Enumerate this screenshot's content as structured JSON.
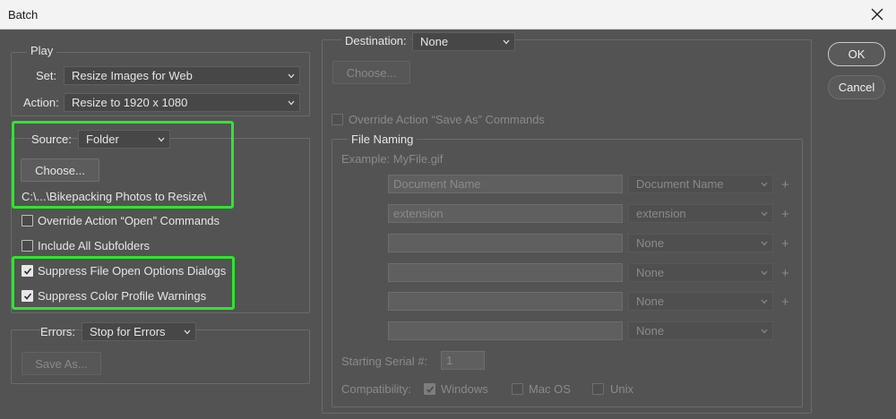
{
  "window": {
    "title": "Batch"
  },
  "play": {
    "legend": "Play",
    "set_label": "Set:",
    "set_value": "Resize Images for Web",
    "action_label": "Action:",
    "action_value": "Resize to 1920 x 1080"
  },
  "source": {
    "label": "Source:",
    "value": "Folder",
    "choose_label": "Choose...",
    "path": "C:\\...\\Bikepacking Photos to Resize\\",
    "override_label": "Override Action “Open” Commands",
    "override_checked": false,
    "subfolders_label": "Include All Subfolders",
    "subfolders_checked": false,
    "suppress_open_label": "Suppress File Open Options Dialogs",
    "suppress_open_checked": true,
    "suppress_color_label": "Suppress Color Profile Warnings",
    "suppress_color_checked": true
  },
  "errors": {
    "label": "Errors:",
    "value": "Stop for Errors",
    "save_as_label": "Save As..."
  },
  "destination": {
    "label": "Destination:",
    "value": "None",
    "choose_label": "Choose...",
    "override_label": "Override Action “Save As” Commands",
    "override_checked": false
  },
  "file_naming": {
    "legend": "File Naming",
    "example": "Example: MyFile.gif",
    "rows": [
      {
        "field": "Document Name",
        "select": "Document Name"
      },
      {
        "field": "extension",
        "select": "extension"
      },
      {
        "field": "",
        "select": "None"
      },
      {
        "field": "",
        "select": "None"
      },
      {
        "field": "",
        "select": "None"
      },
      {
        "field": "",
        "select": "None"
      }
    ],
    "plus": "+",
    "serial_label": "Starting Serial #:",
    "serial_value": "1",
    "compat_label": "Compatibility:",
    "compat_windows": "Windows",
    "compat_windows_checked": true,
    "compat_macos": "Mac OS",
    "compat_macos_checked": false,
    "compat_unix": "Unix",
    "compat_unix_checked": false
  },
  "buttons": {
    "ok": "OK",
    "cancel": "Cancel"
  },
  "colors": {
    "highlight": "#2ee62e",
    "panel": "#535353"
  }
}
